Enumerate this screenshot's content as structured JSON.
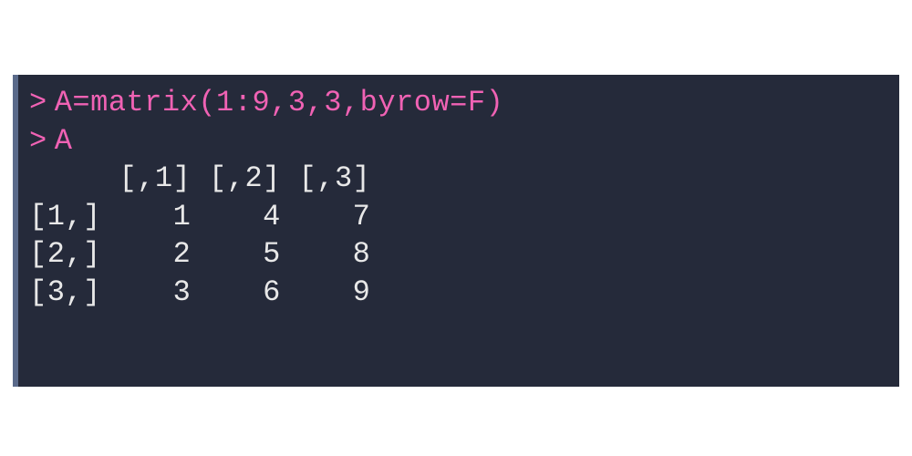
{
  "console": {
    "prompt": ">",
    "lines": [
      {
        "type": "input",
        "text": "A=matrix(1:9,3,3,byrow=F)"
      },
      {
        "type": "input",
        "text": "A"
      },
      {
        "type": "output",
        "text": "     [,1] [,2] [,3]"
      },
      {
        "type": "output",
        "text": "[1,]    1    4    7"
      },
      {
        "type": "output",
        "text": "[2,]    2    5    8"
      },
      {
        "type": "output",
        "text": "[3,]    3    6    9"
      }
    ]
  }
}
